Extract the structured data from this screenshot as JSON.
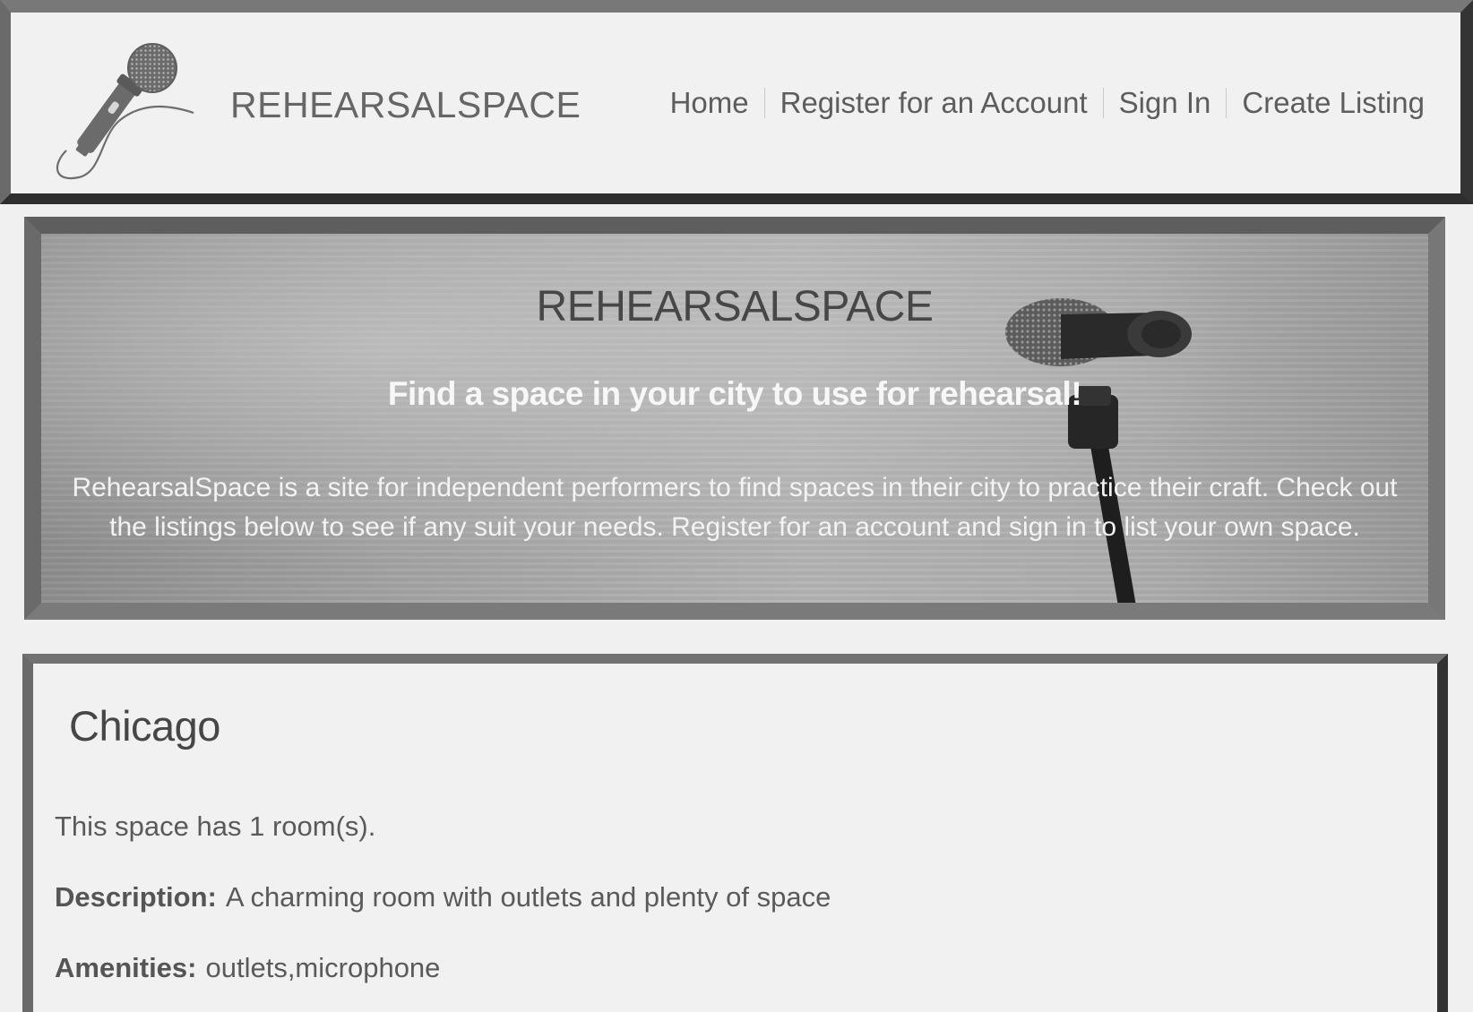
{
  "header": {
    "brand": "REHEARSALSPACE",
    "logo_icon": "microphone-icon",
    "nav": [
      {
        "label": "Home"
      },
      {
        "label": "Register for an Account"
      },
      {
        "label": "Sign In"
      },
      {
        "label": "Create Listing"
      }
    ]
  },
  "hero": {
    "title": "REHEARSALSPACE",
    "subtitle": "Find a space in your city to use for rehearsal!",
    "description": "RehearsalSpace is a site for independent performers to find spaces in their city to practice their craft. Check out the listings below to see if any suit your needs. Register for an account and sign in to list your own space.",
    "background_icon": "microphone-photo"
  },
  "listing": {
    "city": "Chicago",
    "rooms_text": "This space has 1 room(s).",
    "description_label": "Description:",
    "description": "A charming room with outlets and plenty of space",
    "amenities_label": "Amenities:",
    "amenities": "outlets,microphone"
  },
  "colors": {
    "page_background": "#f0f0f0",
    "frame_dark": "#333333",
    "frame_light": "#787878",
    "text": "#555555"
  }
}
